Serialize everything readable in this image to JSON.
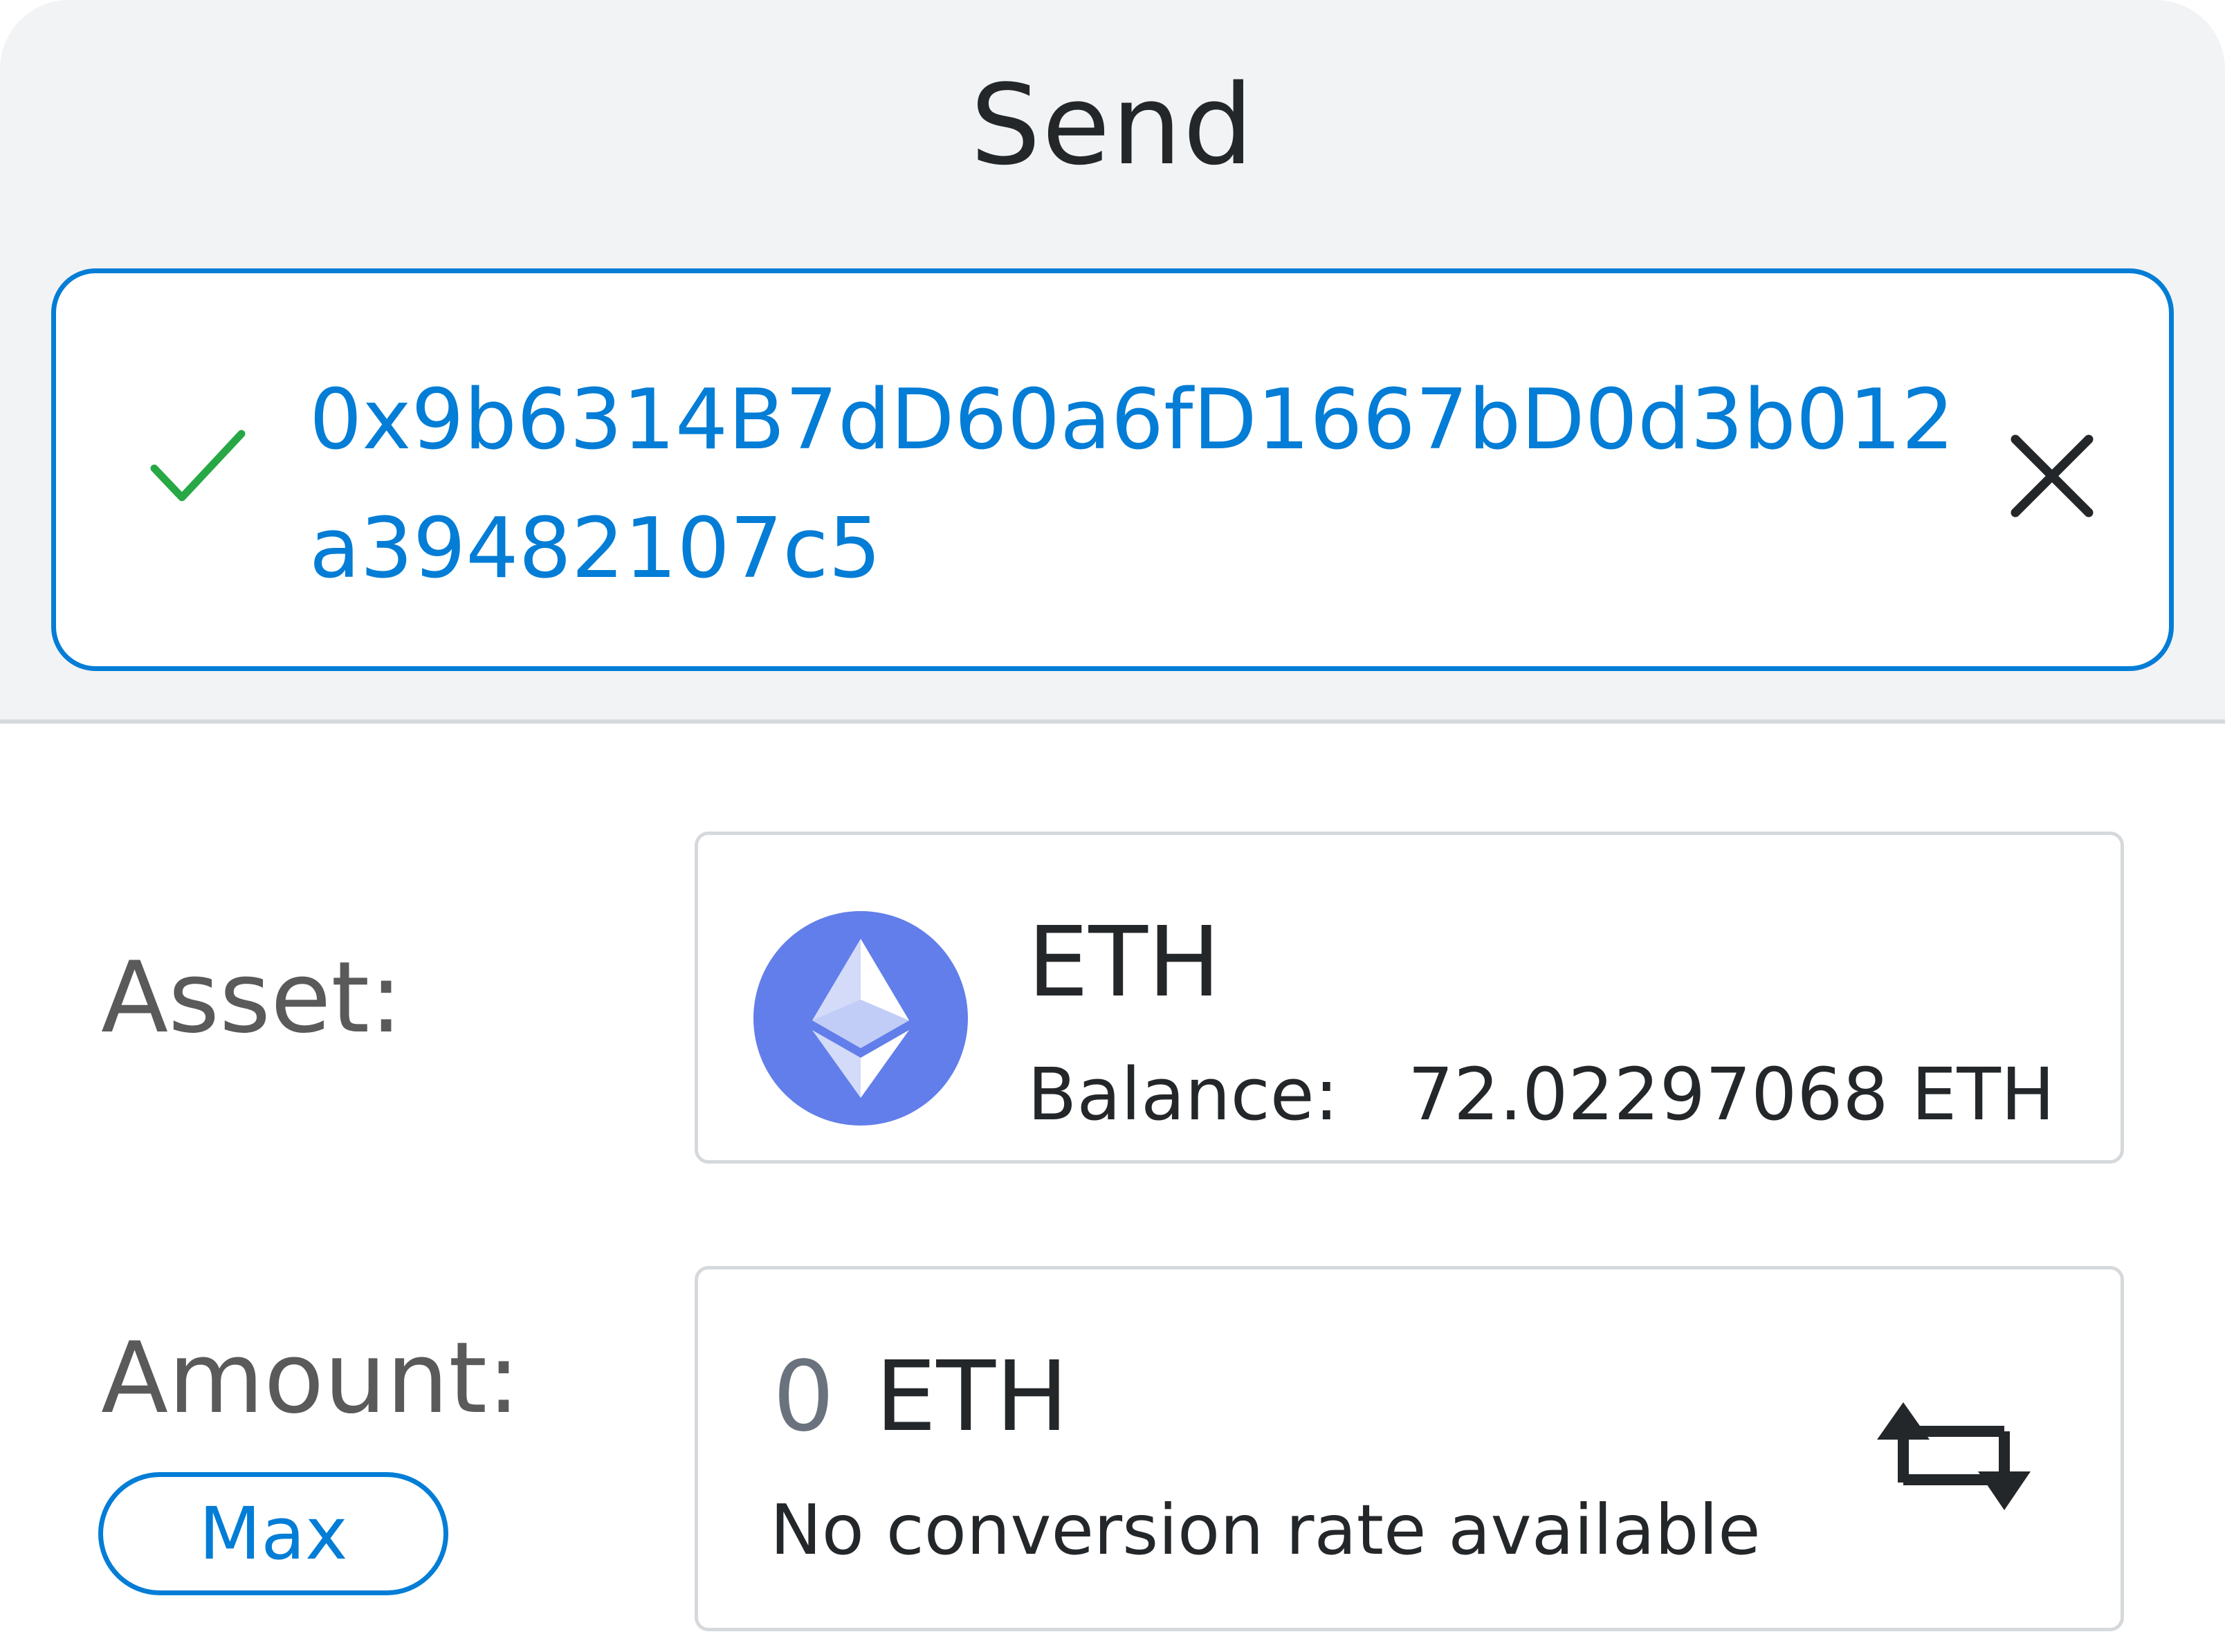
{
  "header": {
    "title": "Send"
  },
  "recipient": {
    "address": "0x9b6314B7dD60a6fD1667bD0d3b012a39482107c5",
    "validated_icon": "check-icon",
    "clear_icon": "close-icon"
  },
  "asset": {
    "label": "Asset:",
    "symbol": "ETH",
    "balance_label": "Balance:",
    "balance_value": "72.02297068 ETH",
    "logo": "ethereum-logo-icon"
  },
  "amount": {
    "label": "Amount:",
    "max_label": "Max",
    "value": "0",
    "unit": "ETH",
    "conversion_note": "No conversion rate available",
    "swap_icon": "swap-arrows-icon"
  },
  "colors": {
    "accent": "#037dd6",
    "success": "#28a745",
    "header_bg": "#f2f3f4",
    "border": "#d6d9dc",
    "eth_logo_bg": "#627eea"
  }
}
